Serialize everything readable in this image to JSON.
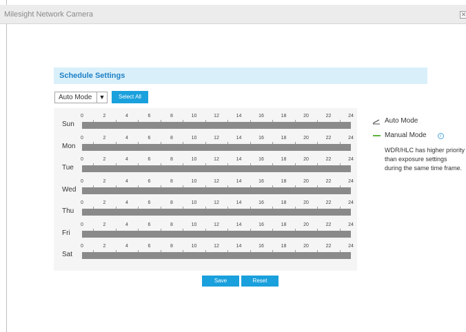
{
  "window": {
    "title": "Milesight Network Camera",
    "close_icon": "close-icon"
  },
  "schedule": {
    "title": "Schedule Settings",
    "mode_select": {
      "value": "Auto Mode",
      "arrow_icon": "chevron-down-icon"
    },
    "select_all_label": "Select All",
    "hour_ticks": [
      "0",
      "2",
      "4",
      "6",
      "8",
      "10",
      "12",
      "14",
      "16",
      "18",
      "20",
      "22",
      "24"
    ],
    "days": [
      "Sun",
      "Mon",
      "Tue",
      "Wed",
      "Thu",
      "Fri",
      "Sat"
    ]
  },
  "legend": {
    "auto_label": "Auto Mode",
    "manual_label": "Manual Mode",
    "manual_color": "#5ab23b",
    "info_icon": "info-icon",
    "note": "WDR/HLC has higher priority than exposure settings during the same time frame."
  },
  "actions": {
    "save_label": "Save",
    "reset_label": "Reset"
  },
  "colors": {
    "accent": "#1aa0dc",
    "header_bg": "#d9f0fb",
    "bar": "#8a8a8a"
  }
}
